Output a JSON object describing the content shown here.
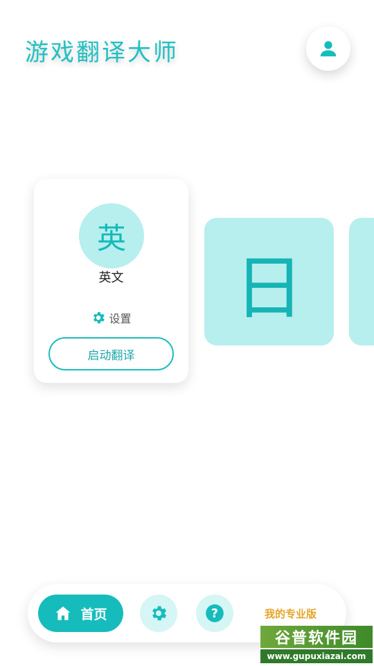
{
  "header": {
    "title": "游戏翻译大师",
    "avatar_icon": "user-icon"
  },
  "language_card": {
    "circle_char": "英",
    "name": "英文",
    "settings_icon": "gear-icon",
    "settings_label": "设置",
    "start_button_label": "启动翻译"
  },
  "language_tiles": [
    {
      "char": "日"
    },
    {
      "char": ""
    }
  ],
  "bottom_nav": {
    "home_icon": "home-icon",
    "home_label": "首页",
    "settings_icon": "gear-icon",
    "help_icon": "question-icon",
    "pro_label": "我的专业版"
  },
  "watermark": {
    "brand": "谷普软件园",
    "url": "www.gupuxiazai.com"
  },
  "colors": {
    "accent": "#16bcbc",
    "accent_light": "#b7eeee",
    "pro_text": "#e6a42b"
  }
}
